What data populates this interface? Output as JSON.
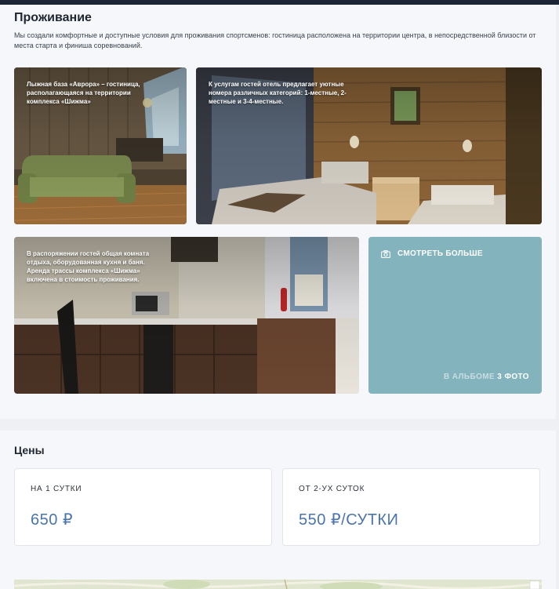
{
  "accommodation": {
    "title": "Проживание",
    "description": "Мы создали комфортные и доступные условия для проживания спортсменов: гостиница расположена на территории центра, в непосредственной близости от места старта и финиша соревнований.",
    "cards": [
      {
        "caption_lines": [
          "Лыжная база «Аврора» – гостиница,",
          "располагающаяся на территории",
          "комплекса «Шижма»"
        ]
      },
      {
        "caption_lines": [
          "К услугам гостей отель предлагает уютные",
          "номера различных категорий: 1-местные, 2-",
          "местные и 3-4-местные."
        ]
      },
      {
        "caption_lines": [
          "В распоряжении гостей общая комната",
          "отдыха, оборудованная кухня и баня.",
          "Аренда трассы комплекса «Шижма»",
          "включена в стоимость проживания."
        ]
      }
    ],
    "more": {
      "icon": "camera-icon",
      "label": "СМОТРЕТЬ БОЛЬШЕ",
      "album_prefix": "В АЛЬБОМЕ",
      "album_count": "3",
      "album_suffix": "ФОТО"
    }
  },
  "prices": {
    "title": "Цены",
    "items": [
      {
        "label": "НА 1 СУТКИ",
        "value": "650 ₽"
      },
      {
        "label": "ОТ 2-УХ СУТОК",
        "value": "550 ₽/СУТКИ"
      }
    ]
  },
  "colors": {
    "accent": "#4a74ab",
    "more_card": "#83b3bd",
    "top_bar": "#1c2536"
  }
}
